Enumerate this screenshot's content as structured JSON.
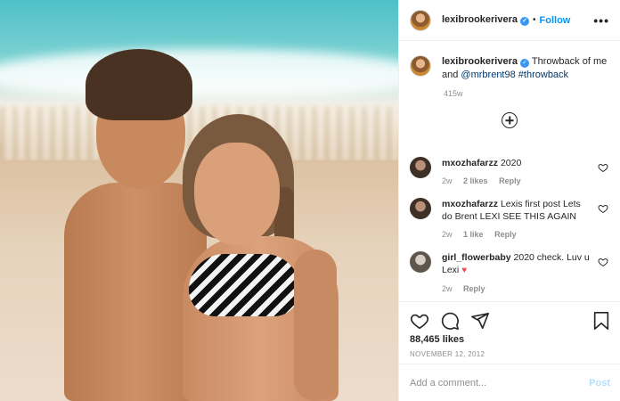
{
  "header": {
    "username": "lexibrookerivera",
    "verified_mark": "✓",
    "separator": "•",
    "follow_label": "Follow",
    "more_label": "•••"
  },
  "caption": {
    "username": "lexibrookerivera",
    "verified_mark": "✓",
    "text_before": "Throwback of me and ",
    "mention": "@mrbrent98",
    "space": " ",
    "hashtag": "#throwback",
    "time": "415w"
  },
  "comments": [
    {
      "username": "mxozhafarzz",
      "text": "2020",
      "time": "2w",
      "likes": "2 likes",
      "reply": "Reply",
      "avatar_color": "#6d5a4c"
    },
    {
      "username": "mxozhafarzz",
      "text": "Lexis first post Lets do Brent LEXI SEE THIS AGAIN",
      "time": "2w",
      "likes": "1 like",
      "reply": "Reply",
      "avatar_color": "#6d5a4c"
    },
    {
      "username": "girl_flowerbaby",
      "text": "2020 check. Luv u Lexi ",
      "emoji": "♥",
      "time": "2w",
      "likes": "",
      "reply": "Reply",
      "avatar_color": "#8d8478"
    }
  ],
  "actions": {
    "likes": "88,465 likes",
    "date": "NOVEMBER 12, 2012"
  },
  "add_comment": {
    "placeholder": "Add a comment...",
    "post_label": "Post"
  },
  "colors": {
    "accent": "#0095f6",
    "verified": "#3897f0",
    "muted": "#8e8e8e",
    "post_disabled": "#b2dffc",
    "heart_red": "#ed4956"
  },
  "icons": [
    "verified-badge-icon",
    "more-options-icon",
    "load-more-icon",
    "heart-icon",
    "comment-icon",
    "share-icon",
    "bookmark-icon"
  ]
}
